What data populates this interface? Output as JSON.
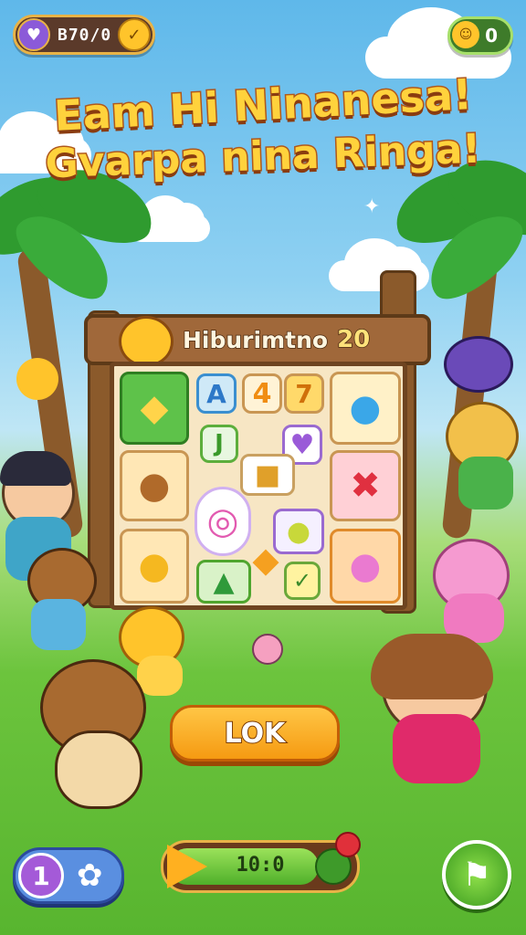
{
  "top_bar": {
    "coins": {
      "icon": "shield-icon",
      "value": "B70/0",
      "add_icon": "coin-plus-icon"
    },
    "gems": {
      "icon": "gem-face-icon",
      "value": "0"
    }
  },
  "title": {
    "line1": "Eam Hi Ninanesa!",
    "line2": "Gvarpa nina Ringa!"
  },
  "board": {
    "sign_label": "Hiburimtno",
    "sign_score": "20",
    "tiles": [
      {
        "icon": "rainbow-crystal-icon",
        "glyph": "◆"
      },
      {
        "icon": "letter-a-tile",
        "glyph": "A"
      },
      {
        "icon": "number-4-tile",
        "glyph": "4"
      },
      {
        "icon": "number-7-tile",
        "glyph": "7"
      },
      {
        "icon": "blue-jelly-icon",
        "glyph": "●"
      },
      {
        "icon": "green-j-tile",
        "glyph": "J"
      },
      {
        "icon": "purple-heart-icon",
        "glyph": "♥"
      },
      {
        "icon": "brown-bear-tile",
        "glyph": "●"
      },
      {
        "icon": "treasure-chest-icon",
        "glyph": "■"
      },
      {
        "icon": "red-bow-icon",
        "glyph": "✖"
      },
      {
        "icon": "rainbow-swirl-candy-icon",
        "glyph": "◎"
      },
      {
        "icon": "yellow-bear-tile",
        "glyph": "●"
      },
      {
        "icon": "candy-pair-icon",
        "glyph": "●"
      },
      {
        "icon": "green-crocodile-icon",
        "glyph": "▲"
      },
      {
        "icon": "orange-gem-icon",
        "glyph": "◆"
      },
      {
        "icon": "check-tile",
        "glyph": "✓"
      },
      {
        "icon": "pink-cat-tile",
        "glyph": "●"
      }
    ]
  },
  "play_button": {
    "label": "LOK"
  },
  "bottom": {
    "level": "1",
    "settings_icon": "flower-gear-icon",
    "energy": {
      "value": "10:0",
      "fill_fraction": 0.82
    },
    "flag_icon": "flag-icon"
  },
  "colors": {
    "accent": "#f59a12",
    "board_wood": "#6e4420",
    "title_fill": "#ffd23c"
  }
}
